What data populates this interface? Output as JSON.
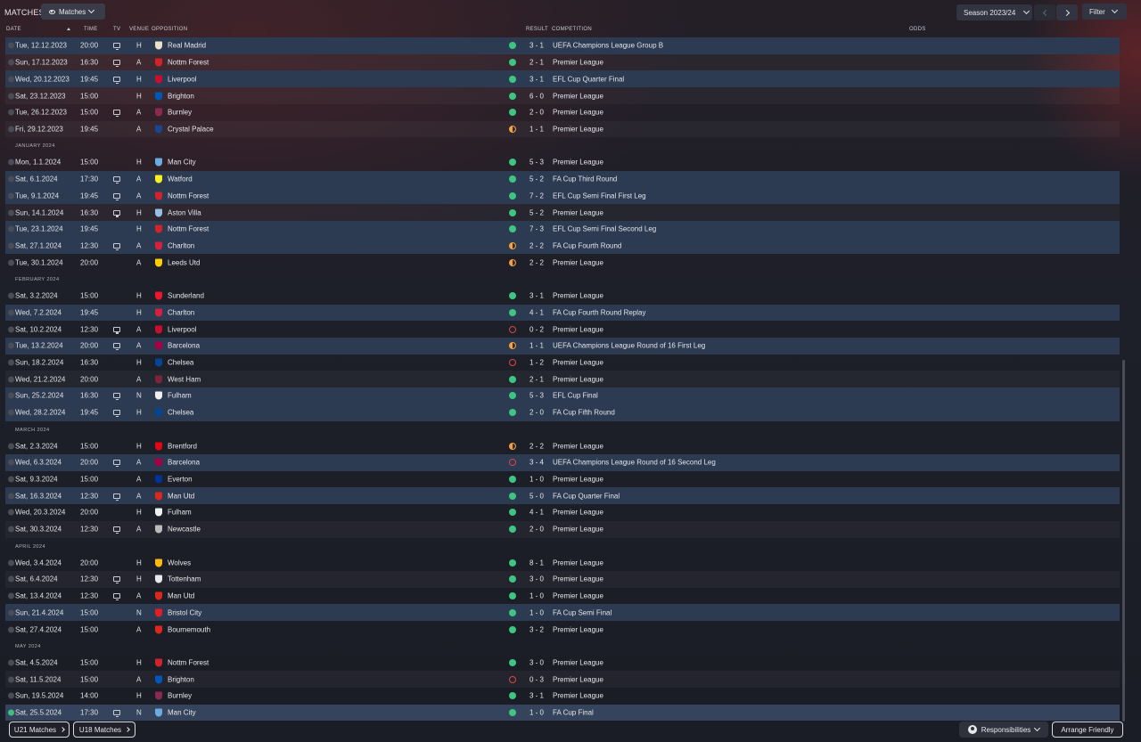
{
  "screen": {
    "title": "MATCHES",
    "view_label": "Matches"
  },
  "controls": {
    "season_label": "Season 2023/24",
    "filter_label": "Filter"
  },
  "columns": {
    "date": "DATE",
    "time": "TIME",
    "tv": "TV",
    "venue": "VENUE",
    "opposition": "OPPOSITION",
    "result": "RESULT",
    "competition": "COMPETITION",
    "odds": "ODDS"
  },
  "colors": {
    "win": "#3ec582",
    "draw": "#f2a23c",
    "loss": "#e04545",
    "cup_row": "#2c3a52"
  },
  "rows": [
    {
      "kind": "match",
      "date": "Tue, 12.12.2023",
      "time": "20:00",
      "tv": true,
      "venue": "H",
      "opponent": "Real Madrid",
      "crest": "#e9e2c8",
      "result": "W",
      "score": "3 - 1",
      "competition": "UEFA Champions League Group B",
      "cup": true
    },
    {
      "kind": "match",
      "date": "Sun, 17.12.2023",
      "time": "16:30",
      "tv": true,
      "venue": "A",
      "opponent": "Nottm Forest",
      "crest": "#d1232a",
      "result": "W",
      "score": "2 - 1",
      "competition": "Premier League",
      "cup": false
    },
    {
      "kind": "match",
      "date": "Wed, 20.12.2023",
      "time": "19:45",
      "tv": true,
      "venue": "H",
      "opponent": "Liverpool",
      "crest": "#c8102e",
      "result": "W",
      "score": "3 - 1",
      "competition": "EFL Cup Quarter Final",
      "cup": true
    },
    {
      "kind": "match",
      "date": "Sat, 23.12.2023",
      "time": "15:00",
      "tv": false,
      "venue": "H",
      "opponent": "Brighton",
      "crest": "#0057b8",
      "result": "W",
      "score": "6 - 0",
      "competition": "Premier League",
      "cup": false
    },
    {
      "kind": "match",
      "date": "Tue, 26.12.2023",
      "time": "15:00",
      "tv": true,
      "venue": "A",
      "opponent": "Burnley",
      "crest": "#8a2a52",
      "result": "W",
      "score": "2 - 0",
      "competition": "Premier League",
      "cup": false
    },
    {
      "kind": "match",
      "date": "Fri, 29.12.2023",
      "time": "19:45",
      "tv": false,
      "venue": "A",
      "opponent": "Crystal Palace",
      "crest": "#1b458f",
      "result": "D",
      "score": "1 - 1",
      "competition": "Premier League",
      "cup": false
    },
    {
      "kind": "month",
      "label": "JANUARY 2024"
    },
    {
      "kind": "match",
      "date": "Mon, 1.1.2024",
      "time": "15:00",
      "tv": false,
      "venue": "H",
      "opponent": "Man City",
      "crest": "#6cabdd",
      "result": "W",
      "score": "5 - 3",
      "competition": "Premier League",
      "cup": false
    },
    {
      "kind": "match",
      "date": "Sat, 6.1.2024",
      "time": "17:30",
      "tv": true,
      "venue": "A",
      "opponent": "Watford",
      "crest": "#fbee23",
      "result": "W",
      "score": "5 - 2",
      "competition": "FA Cup Third Round",
      "cup": true
    },
    {
      "kind": "match",
      "date": "Tue, 9.1.2024",
      "time": "19:45",
      "tv": true,
      "venue": "A",
      "opponent": "Nottm Forest",
      "crest": "#d1232a",
      "result": "W",
      "score": "7 - 2",
      "competition": "EFL Cup Semi Final First Leg",
      "cup": true
    },
    {
      "kind": "match",
      "date": "Sun, 14.1.2024",
      "time": "16:30",
      "tv": true,
      "venue": "H",
      "opponent": "Aston Villa",
      "crest": "#95bfe5",
      "result": "W",
      "score": "5 - 2",
      "competition": "Premier League",
      "cup": false
    },
    {
      "kind": "match",
      "date": "Tue, 23.1.2024",
      "time": "19:45",
      "tv": false,
      "venue": "H",
      "opponent": "Nottm Forest",
      "crest": "#d1232a",
      "result": "W",
      "score": "7 - 3",
      "competition": "EFL Cup Semi Final Second Leg",
      "cup": true
    },
    {
      "kind": "match",
      "date": "Sat, 27.1.2024",
      "time": "12:30",
      "tv": true,
      "venue": "A",
      "opponent": "Charlton",
      "crest": "#d4213d",
      "result": "D",
      "score": "2 - 2",
      "competition": "FA Cup Fourth Round",
      "cup": true
    },
    {
      "kind": "match",
      "date": "Tue, 30.1.2024",
      "time": "20:00",
      "tv": false,
      "venue": "A",
      "opponent": "Leeds Utd",
      "crest": "#ffcd00",
      "result": "D",
      "score": "2 - 2",
      "competition": "Premier League",
      "cup": false
    },
    {
      "kind": "month",
      "label": "FEBRUARY 2024"
    },
    {
      "kind": "match",
      "date": "Sat, 3.2.2024",
      "time": "15:00",
      "tv": false,
      "venue": "H",
      "opponent": "Sunderland",
      "crest": "#eb172b",
      "result": "W",
      "score": "3 - 1",
      "competition": "Premier League",
      "cup": false
    },
    {
      "kind": "match",
      "date": "Wed, 7.2.2024",
      "time": "19:45",
      "tv": false,
      "venue": "H",
      "opponent": "Charlton",
      "crest": "#d4213d",
      "result": "W",
      "score": "4 - 1",
      "competition": "FA Cup Fourth Round Replay",
      "cup": true
    },
    {
      "kind": "match",
      "date": "Sat, 10.2.2024",
      "time": "12:30",
      "tv": true,
      "venue": "A",
      "opponent": "Liverpool",
      "crest": "#c8102e",
      "result": "L",
      "score": "0 - 2",
      "competition": "Premier League",
      "cup": false
    },
    {
      "kind": "match",
      "date": "Tue, 13.2.2024",
      "time": "20:00",
      "tv": true,
      "venue": "A",
      "opponent": "Barcelona",
      "crest": "#a50044",
      "result": "D",
      "score": "1 - 1",
      "competition": "UEFA Champions League Round of 16 First Leg",
      "cup": true
    },
    {
      "kind": "match",
      "date": "Sun, 18.2.2024",
      "time": "16:30",
      "tv": false,
      "venue": "H",
      "opponent": "Chelsea",
      "crest": "#034694",
      "result": "L",
      "score": "1 - 2",
      "competition": "Premier League",
      "cup": false
    },
    {
      "kind": "match",
      "date": "Wed, 21.2.2024",
      "time": "20:00",
      "tv": false,
      "venue": "A",
      "opponent": "West Ham",
      "crest": "#7a263a",
      "result": "W",
      "score": "2 - 1",
      "competition": "Premier League",
      "cup": false
    },
    {
      "kind": "match",
      "date": "Sun, 25.2.2024",
      "time": "16:30",
      "tv": true,
      "venue": "N",
      "opponent": "Fulham",
      "crest": "#f0f0f0",
      "result": "W",
      "score": "5 - 3",
      "competition": "EFL Cup Final",
      "cup": true
    },
    {
      "kind": "match",
      "date": "Wed, 28.2.2024",
      "time": "19:45",
      "tv": true,
      "venue": "H",
      "opponent": "Chelsea",
      "crest": "#034694",
      "result": "W",
      "score": "2 - 0",
      "competition": "FA Cup Fifth Round",
      "cup": true
    },
    {
      "kind": "month",
      "label": "MARCH 2024"
    },
    {
      "kind": "match",
      "date": "Sat, 2.3.2024",
      "time": "15:00",
      "tv": false,
      "venue": "H",
      "opponent": "Brentford",
      "crest": "#e30613",
      "result": "D",
      "score": "2 - 2",
      "competition": "Premier League",
      "cup": false
    },
    {
      "kind": "match",
      "date": "Wed, 6.3.2024",
      "time": "20:00",
      "tv": true,
      "venue": "A",
      "opponent": "Barcelona",
      "crest": "#a50044",
      "result": "L",
      "score": "3 - 4",
      "competition": "UEFA Champions League Round of 16 Second Leg",
      "cup": true
    },
    {
      "kind": "match",
      "date": "Sat, 9.3.2024",
      "time": "15:00",
      "tv": false,
      "venue": "A",
      "opponent": "Everton",
      "crest": "#003399",
      "result": "W",
      "score": "1 - 0",
      "competition": "Premier League",
      "cup": false
    },
    {
      "kind": "match",
      "date": "Sat, 16.3.2024",
      "time": "12:30",
      "tv": true,
      "venue": "A",
      "opponent": "Man Utd",
      "crest": "#da291c",
      "result": "W",
      "score": "5 - 0",
      "competition": "FA Cup Quarter Final",
      "cup": true
    },
    {
      "kind": "match",
      "date": "Wed, 20.3.2024",
      "time": "20:00",
      "tv": false,
      "venue": "H",
      "opponent": "Fulham",
      "crest": "#f0f0f0",
      "result": "W",
      "score": "4 - 1",
      "competition": "Premier League",
      "cup": false
    },
    {
      "kind": "match",
      "date": "Sat, 30.3.2024",
      "time": "12:30",
      "tv": true,
      "venue": "A",
      "opponent": "Newcastle",
      "crest": "#bbbbbb",
      "result": "W",
      "score": "2 - 0",
      "competition": "Premier League",
      "cup": false
    },
    {
      "kind": "month",
      "label": "APRIL 2024"
    },
    {
      "kind": "match",
      "date": "Wed, 3.4.2024",
      "time": "20:00",
      "tv": false,
      "venue": "H",
      "opponent": "Wolves",
      "crest": "#fdb913",
      "result": "W",
      "score": "8 - 1",
      "competition": "Premier League",
      "cup": false
    },
    {
      "kind": "match",
      "date": "Sat, 6.4.2024",
      "time": "12:30",
      "tv": true,
      "venue": "H",
      "opponent": "Tottenham",
      "crest": "#e8e8ee",
      "result": "W",
      "score": "3 - 0",
      "competition": "Premier League",
      "cup": false
    },
    {
      "kind": "match",
      "date": "Sat, 13.4.2024",
      "time": "12:30",
      "tv": true,
      "venue": "A",
      "opponent": "Man Utd",
      "crest": "#da291c",
      "result": "W",
      "score": "1 - 0",
      "competition": "Premier League",
      "cup": false
    },
    {
      "kind": "match",
      "date": "Sun, 21.4.2024",
      "time": "15:00",
      "tv": false,
      "venue": "N",
      "opponent": "Bristol City",
      "crest": "#e21f26",
      "result": "W",
      "score": "1 - 0",
      "competition": "FA Cup Semi Final",
      "cup": true
    },
    {
      "kind": "match",
      "date": "Sat, 27.4.2024",
      "time": "15:00",
      "tv": false,
      "venue": "A",
      "opponent": "Bournemouth",
      "crest": "#da291c",
      "result": "W",
      "score": "3 - 2",
      "competition": "Premier League",
      "cup": false
    },
    {
      "kind": "month",
      "label": "MAY 2024"
    },
    {
      "kind": "match",
      "date": "Sat, 4.5.2024",
      "time": "15:00",
      "tv": false,
      "venue": "H",
      "opponent": "Nottm Forest",
      "crest": "#d1232a",
      "result": "W",
      "score": "3 - 0",
      "competition": "Premier League",
      "cup": false
    },
    {
      "kind": "match",
      "date": "Sat, 11.5.2024",
      "time": "15:00",
      "tv": false,
      "venue": "A",
      "opponent": "Brighton",
      "crest": "#0057b8",
      "result": "L",
      "score": "0 - 3",
      "competition": "Premier League",
      "cup": false
    },
    {
      "kind": "match",
      "date": "Sun, 19.5.2024",
      "time": "14:00",
      "tv": false,
      "venue": "H",
      "opponent": "Burnley",
      "crest": "#8a2a52",
      "result": "W",
      "score": "3 - 1",
      "competition": "Premier League",
      "cup": false
    },
    {
      "kind": "match",
      "date": "Sat, 25.5.2024",
      "time": "17:30",
      "tv": true,
      "venue": "N",
      "opponent": "Man City",
      "crest": "#6cabdd",
      "result": "W",
      "score": "1 - 0",
      "competition": "FA Cup Final",
      "cup": true,
      "checked": true
    }
  ],
  "footer": {
    "u21_label": "U21 Matches",
    "u18_label": "U18 Matches",
    "responsibilities_label": "Responsibilities",
    "arrange_label": "Arrange Friendly"
  }
}
